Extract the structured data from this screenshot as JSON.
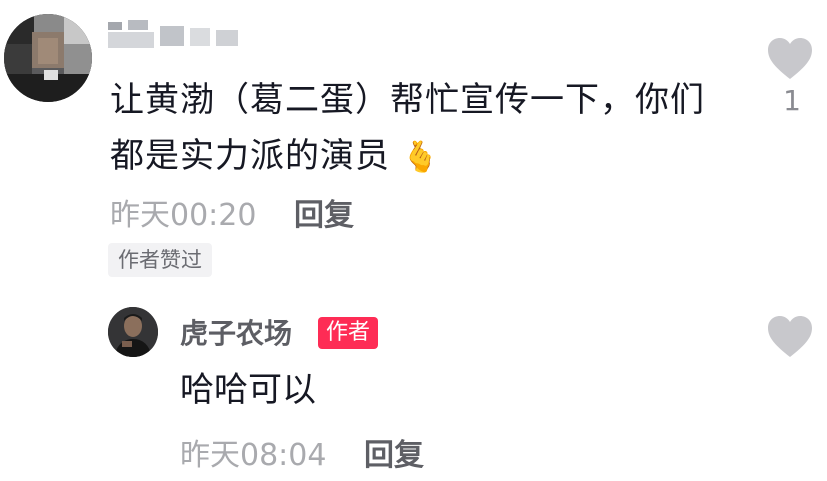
{
  "comment": {
    "text": "让黄渤（葛二蛋）帮忙宣传一下，你们都是实力派的演员 ",
    "emoji": "🫰",
    "likes": "1",
    "time": "昨天00:20",
    "reply_label": "回复",
    "author_liked_label": "作者赞过",
    "heart_icon": "heart-outline-icon"
  },
  "reply": {
    "username": "虎子农场",
    "author_badge": "作者",
    "text": "哈哈可以",
    "time": "昨天08:04",
    "reply_label": "回复",
    "heart_icon": "heart-outline-icon"
  },
  "colors": {
    "heart": "#c8c8cc",
    "badge": "#fe2c55",
    "text": "#161823",
    "meta": "#a9aaae"
  }
}
